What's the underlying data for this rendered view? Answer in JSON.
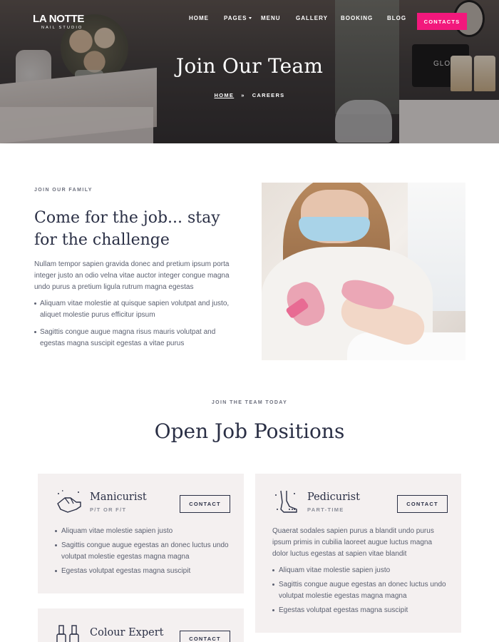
{
  "brand": {
    "name": "LA NOTTE",
    "tagline": "NAIL STUDIO"
  },
  "nav": {
    "items": [
      "HOME",
      "PAGES",
      "MENU",
      "GALLERY",
      "BOOKING",
      "BLOG"
    ],
    "cta": "CONTACTS"
  },
  "hero": {
    "title": "Join Our Team",
    "breadcrumb": {
      "home": "HOME",
      "separator": "»",
      "current": "CAREERS"
    },
    "station_label": "GLOSS"
  },
  "intro": {
    "eyebrow": "JOIN OUR FAMILY",
    "title": "Come for the job... stay for the challenge",
    "text": "Nullam tempor sapien gravida donec and pretium ipsum porta integer justo an odio velna vitae auctor integer congue magna undo purus a pretium ligula rutrum magna egestas",
    "bullets": [
      "Aliquam vitae molestie at quisque sapien volutpat and justo, aliquet molestie purus efficitur ipsum",
      "Sagittis congue augue magna risus mauris volutpat and egestas magna suscipit egestas a vitae purus"
    ]
  },
  "positions": {
    "eyebrow": "JOIN THE TEAM TODAY",
    "title": "Open Job Positions",
    "cards": [
      {
        "title": "Manicurist",
        "type": "P/T OR F/T",
        "button": "CONTACT",
        "icon": "manicure-hand-icon",
        "description": "",
        "bullets": [
          "Aliquam vitae molestie sapien justo",
          "Sagittis congue augue egestas an donec luctus undo volutpat molestie egestas magna magna",
          "Egestas volutpat egestas magna suscipit"
        ]
      },
      {
        "title": "Pedicurist",
        "type": "PART-TIME",
        "button": "CONTACT",
        "icon": "pedicure-foot-icon",
        "description": "Quaerat sodales sapien purus a blandit undo purus ipsum primis in cubilia laoreet augue luctus magna dolor luctus egestas at sapien vitae blandit",
        "bullets": [
          "Aliquam vitae molestie sapien justo",
          "Sagittis congue augue egestas an donec luctus undo volutpat molestie egestas magna magna",
          "Egestas volutpat egestas magna suscipit"
        ]
      },
      {
        "title": "Colour Expert",
        "type": "",
        "button": "CONTACT",
        "icon": "nail-polish-icon",
        "description": "",
        "bullets": []
      }
    ]
  },
  "colors": {
    "accent": "#f2187c",
    "heading": "#2a2f45",
    "card_bg": "#f4f0f0"
  }
}
